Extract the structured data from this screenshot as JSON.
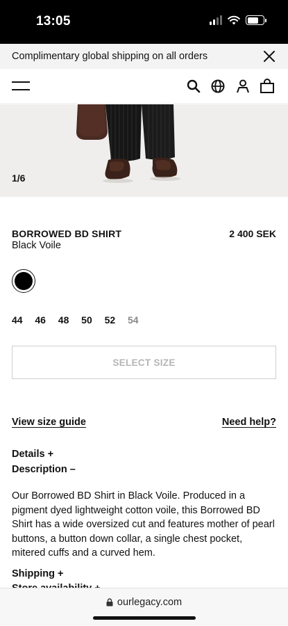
{
  "status": {
    "time": "13:05"
  },
  "announcement": {
    "text": "Complimentary global shipping on all orders"
  },
  "gallery": {
    "counter": "1/6"
  },
  "product": {
    "name": "BORROWED BD SHIRT",
    "color": "Black Voile",
    "price": "2 400 SEK",
    "swatch_color": "#000000"
  },
  "sizes": [
    {
      "label": "44",
      "available": true
    },
    {
      "label": "46",
      "available": true
    },
    {
      "label": "48",
      "available": true
    },
    {
      "label": "50",
      "available": true
    },
    {
      "label": "52",
      "available": true
    },
    {
      "label": "54",
      "available": false
    }
  ],
  "select_size_label": "SELECT SIZE",
  "links": {
    "size_guide": "View size guide",
    "need_help": "Need help?"
  },
  "accordion": {
    "details": "Details +",
    "description": "Description –",
    "shipping": "Shipping +",
    "store": "Store availability +"
  },
  "description_text": "Our Borrowed BD Shirt in Black Voile. Produced in a pigment dyed lightweight cotton voile, this Borrowed BD Shirt has a wide oversized cut and features mother of pearl buttons, a button down collar, a single chest pocket, mitered cuffs and a curved hem.",
  "browser": {
    "url": "ourlegacy.com"
  }
}
